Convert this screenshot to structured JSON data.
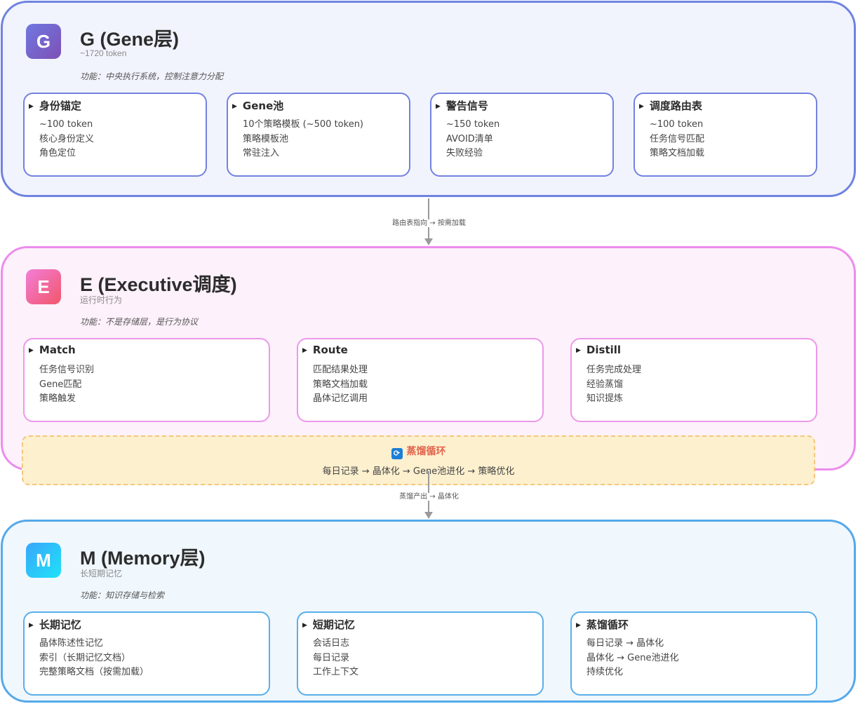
{
  "layers": {
    "g": {
      "badge": "G",
      "title": "G (Gene层)",
      "subtitle": "~1720 token",
      "function": "功能：中央执行系统，控制注意力分配",
      "cards": [
        {
          "title": "身份锚定",
          "lines": [
            "~100 token",
            "核心身份定义",
            "角色定位"
          ]
        },
        {
          "title": "Gene池",
          "lines": [
            "10个策略模板 (~500 token)",
            "策略模板池",
            "常驻注入"
          ]
        },
        {
          "title": "警告信号",
          "lines": [
            "~150 token",
            "AVOID清单",
            "失败经验"
          ]
        },
        {
          "title": "调度路由表",
          "lines": [
            "~100 token",
            "任务信号匹配",
            "策略文档加载"
          ]
        }
      ]
    },
    "e": {
      "badge": "E",
      "title": "E (Executive调度)",
      "subtitle": "运行时行为",
      "function": "功能：不是存储层，是行为协议",
      "cards": [
        {
          "title": "Match",
          "lines": [
            "任务信号识别",
            "Gene匹配",
            "策略触发"
          ]
        },
        {
          "title": "Route",
          "lines": [
            "匹配结果处理",
            "策略文档加载",
            "晶体记忆调用"
          ]
        },
        {
          "title": "Distill",
          "lines": [
            "任务完成处理",
            "经验蒸馏",
            "知识提炼"
          ]
        }
      ]
    },
    "m": {
      "badge": "M",
      "title": "M (Memory层)",
      "subtitle": "长短期记忆",
      "function": "功能：知识存储与检索",
      "cards": [
        {
          "title": "长期记忆",
          "lines": [
            "晶体陈述性记忆",
            "索引（长期记忆文档）",
            "完整策略文档（按需加载）"
          ]
        },
        {
          "title": "短期记忆",
          "lines": [
            "会话日志",
            "每日记录",
            "工作上下文"
          ]
        },
        {
          "title": "蒸馏循环",
          "lines": [
            "每日记录 → 晶体化",
            "晶体化 → Gene池进化",
            "持续优化"
          ]
        }
      ]
    }
  },
  "connectors": {
    "g_to_e": "路由表指向 → 按需加载",
    "e_to_m": "蒸馏产出 → 晶体化"
  },
  "distill_cycle": {
    "icon": "cycle-arrows-icon",
    "title": "蒸馏循环",
    "flow": "每日记录 → 晶体化 → Gene池进化 → 策略优化"
  },
  "colors": {
    "g_border": "#6f84e0",
    "e_border": "#ec8ded",
    "m_border": "#55a9ea",
    "distill_title": "#e2614a",
    "distill_bg": "#fdf0cf"
  }
}
